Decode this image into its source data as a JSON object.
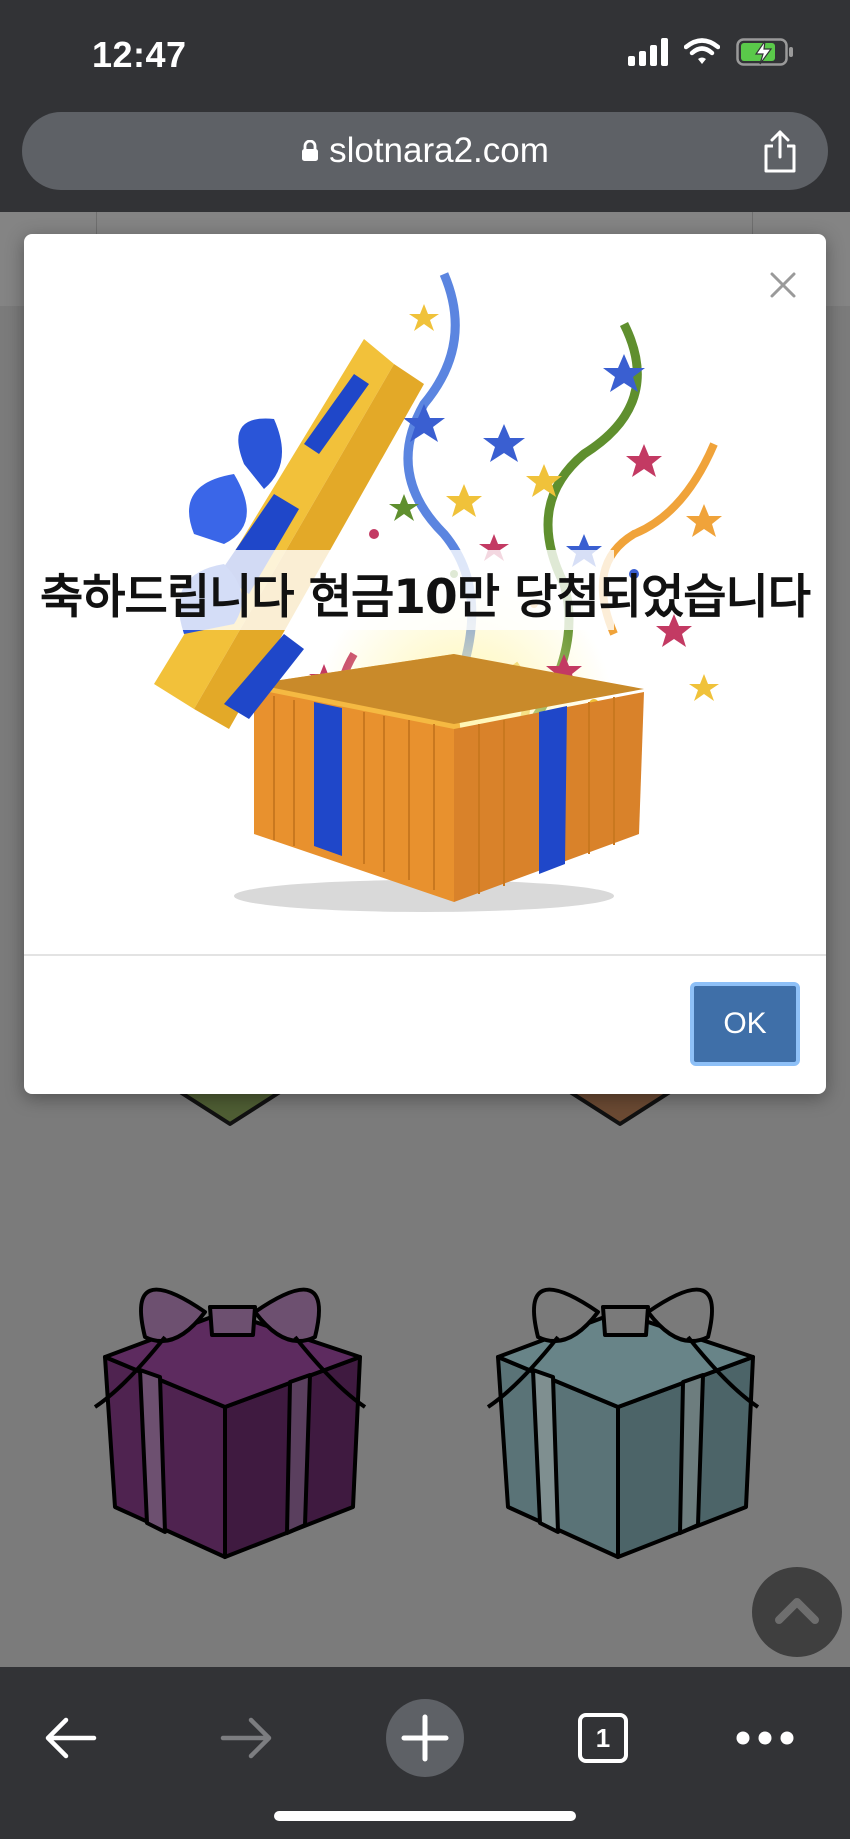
{
  "status_bar": {
    "time": "12:47"
  },
  "browser": {
    "url": "slotnara2.com",
    "tab_count": "1"
  },
  "modal": {
    "message": "축하드립니다 현금10만 당첨되었습니다",
    "ok_label": "OK"
  },
  "colors": {
    "browser_chrome": "#323336",
    "url_pill": "#5e6166",
    "ok_button": "#3f6fa8",
    "ok_button_border": "#8ec0f7",
    "battery_green": "#5ac94a",
    "gift_purple": "#4f2350",
    "gift_teal": "#5a7377"
  },
  "icons": {
    "status": [
      "signal-icon",
      "wifi-icon",
      "battery-charging-icon"
    ],
    "url": [
      "lock-icon",
      "share-icon"
    ],
    "modal": [
      "close-icon"
    ],
    "page": [
      "gift-box-icon",
      "chevron-up-icon"
    ],
    "toolbar": [
      "back-arrow-icon",
      "forward-arrow-icon",
      "new-tab-plus-icon",
      "tabs-icon",
      "more-dots-icon"
    ]
  }
}
